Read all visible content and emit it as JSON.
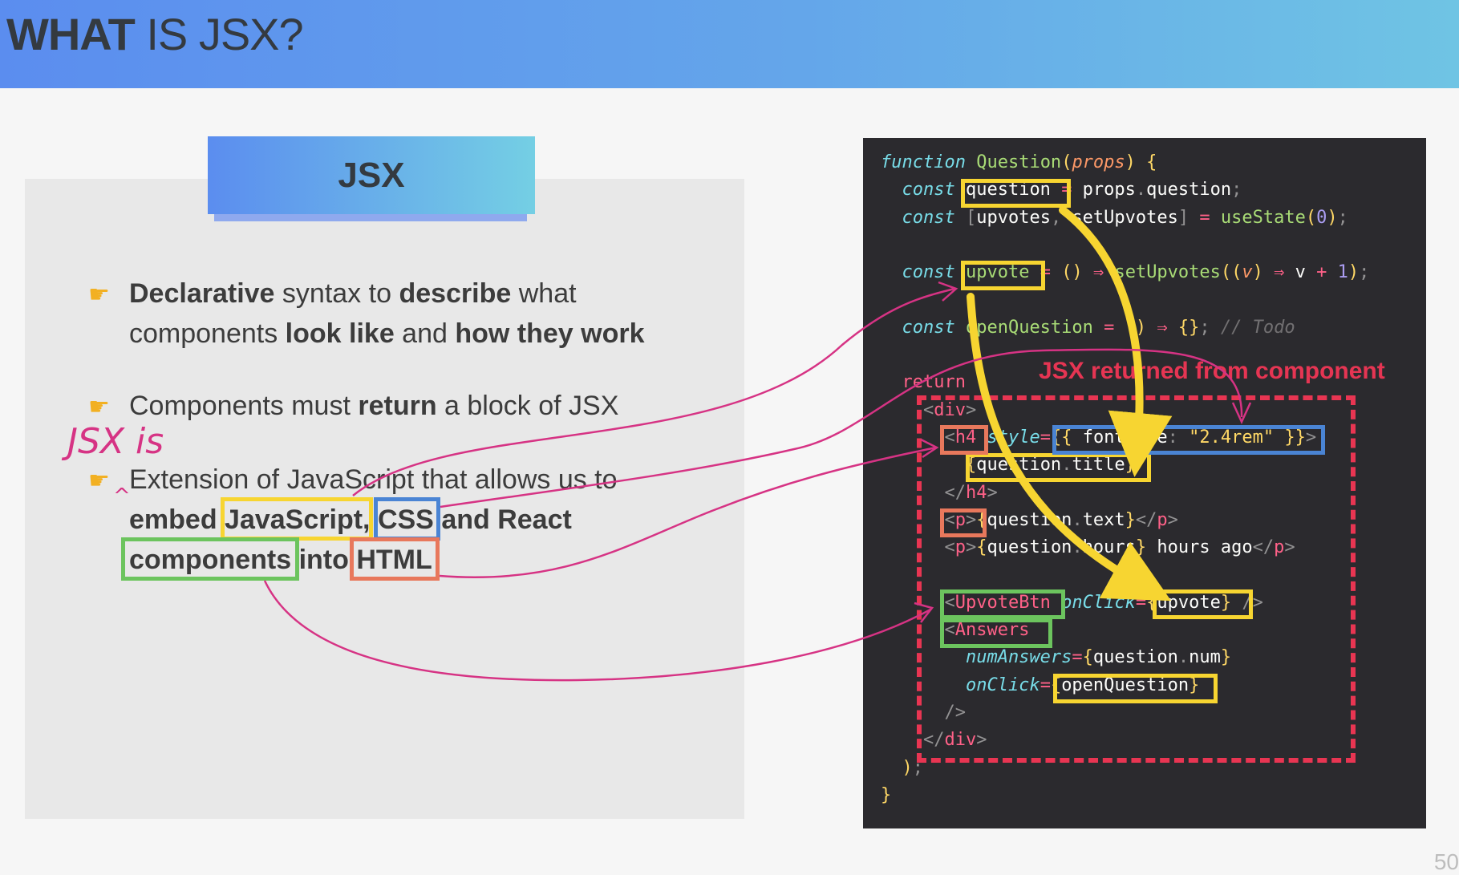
{
  "slide": {
    "title_bold": "WHAT",
    "title_rest": " IS JSX?",
    "page_number": "50"
  },
  "left": {
    "label": "JSX",
    "bullets": [
      {
        "icon": "pointing-hand-icon",
        "line1": [
          {
            "t": "Declarative",
            "b": true
          },
          {
            "t": " syntax to ",
            "b": false
          },
          {
            "t": "describe",
            "b": true
          },
          {
            "t": " what",
            "b": false
          }
        ],
        "line2": [
          {
            "t": "components ",
            "b": false
          },
          {
            "t": "look like",
            "b": true
          },
          {
            "t": " and ",
            "b": false
          },
          {
            "t": "how they work",
            "b": true
          }
        ]
      },
      {
        "icon": "pointing-hand-icon",
        "line1": [
          {
            "t": "Components must ",
            "b": false
          },
          {
            "t": "return",
            "b": true
          },
          {
            "t": " a block of JSX",
            "b": false
          }
        ]
      },
      {
        "icon": "pointing-hand-icon",
        "line1": [
          {
            "t": "Extension of JavaScript that allows us to",
            "b": false
          }
        ],
        "line2": [
          {
            "t": "embed ",
            "b": true
          },
          {
            "t": "JavaScript",
            "b": true
          },
          {
            "t": ", ",
            "b": true
          },
          {
            "t": "CSS",
            "b": true
          },
          {
            "t": " and React",
            "b": true
          }
        ],
        "line3": [
          {
            "t": "components",
            "b": true
          },
          {
            "t": " into ",
            "b": true
          },
          {
            "t": "HTML",
            "b": true
          }
        ]
      }
    ],
    "handwritten_note": "JSX is",
    "caret_mark": "^"
  },
  "code": {
    "lines": [
      [
        [
          "kw",
          "function"
        ],
        [
          "id",
          " "
        ],
        [
          "fn",
          "Question"
        ],
        [
          "br",
          "("
        ],
        [
          "param",
          "props"
        ],
        [
          "br",
          ")"
        ],
        [
          "id",
          " "
        ],
        [
          "br",
          "{"
        ]
      ],
      [
        [
          "kw",
          "  const"
        ],
        [
          "id",
          " "
        ],
        [
          "id",
          "question"
        ],
        [
          "id",
          " "
        ],
        [
          "op",
          "="
        ],
        [
          "id",
          " props"
        ],
        [
          "pct",
          "."
        ],
        [
          "id",
          "question"
        ],
        [
          "pct",
          ";"
        ]
      ],
      [
        [
          "kw",
          "  const"
        ],
        [
          "id",
          " "
        ],
        [
          "pct",
          "["
        ],
        [
          "id",
          "upvotes"
        ],
        [
          "pct",
          ", "
        ],
        [
          "id",
          "setUpvotes"
        ],
        [
          "pct",
          "]"
        ],
        [
          "id",
          " "
        ],
        [
          "op",
          "="
        ],
        [
          "id",
          " "
        ],
        [
          "fn",
          "useState"
        ],
        [
          "br",
          "("
        ],
        [
          "num",
          "0"
        ],
        [
          "br",
          ")"
        ],
        [
          "pct",
          ";"
        ]
      ],
      [],
      [
        [
          "kw",
          "  const"
        ],
        [
          "id",
          " "
        ],
        [
          "fn",
          "upvote"
        ],
        [
          "id",
          " "
        ],
        [
          "op",
          "="
        ],
        [
          "id",
          " "
        ],
        [
          "br",
          "()"
        ],
        [
          "id",
          " "
        ],
        [
          "op",
          "⇒"
        ],
        [
          "id",
          " "
        ],
        [
          "fn",
          "setUpvotes"
        ],
        [
          "br",
          "(("
        ],
        [
          "param",
          "v"
        ],
        [
          "br",
          ")"
        ],
        [
          "id",
          " "
        ],
        [
          "op",
          "⇒"
        ],
        [
          "id",
          " v "
        ],
        [
          "op",
          "+"
        ],
        [
          "id",
          " "
        ],
        [
          "num",
          "1"
        ],
        [
          "br",
          ")"
        ],
        [
          "pct",
          ";"
        ]
      ],
      [],
      [
        [
          "kw",
          "  const"
        ],
        [
          "id",
          " "
        ],
        [
          "fn",
          "openQuestion"
        ],
        [
          "id",
          " "
        ],
        [
          "op",
          "="
        ],
        [
          "id",
          " "
        ],
        [
          "br",
          "()"
        ],
        [
          "id",
          " "
        ],
        [
          "op",
          "⇒"
        ],
        [
          "id",
          " "
        ],
        [
          "br",
          "{}"
        ],
        [
          "pct",
          ";"
        ],
        [
          "id",
          " "
        ],
        [
          "cm",
          "// Todo"
        ]
      ],
      [],
      [
        [
          "op",
          "  return"
        ],
        [
          "id",
          " "
        ],
        [
          "br",
          "("
        ]
      ],
      [
        [
          "pct",
          "    <"
        ],
        [
          "tag",
          "div"
        ],
        [
          "pct",
          ">"
        ]
      ],
      [
        [
          "pct",
          "      <"
        ],
        [
          "tag",
          "h4"
        ],
        [
          "id",
          " "
        ],
        [
          "kw",
          "style"
        ],
        [
          "op",
          "="
        ],
        [
          "br",
          "{{"
        ],
        [
          "id",
          " fontSize"
        ],
        [
          "pct",
          ":"
        ],
        [
          "id",
          " "
        ],
        [
          "str",
          "\"2.4rem\""
        ],
        [
          "id",
          " "
        ],
        [
          "br",
          "}}"
        ],
        [
          "pct",
          ">"
        ]
      ],
      [
        [
          "br",
          "        {"
        ],
        [
          "id",
          "question"
        ],
        [
          "pct",
          "."
        ],
        [
          "id",
          "title"
        ],
        [
          "br",
          "}"
        ]
      ],
      [
        [
          "pct",
          "      </"
        ],
        [
          "tag",
          "h4"
        ],
        [
          "pct",
          ">"
        ]
      ],
      [
        [
          "pct",
          "      <"
        ],
        [
          "tag",
          "p"
        ],
        [
          "pct",
          ">"
        ],
        [
          "br",
          "{"
        ],
        [
          "id",
          "question"
        ],
        [
          "pct",
          "."
        ],
        [
          "id",
          "text"
        ],
        [
          "br",
          "}"
        ],
        [
          "pct",
          "</"
        ],
        [
          "tag",
          "p"
        ],
        [
          "pct",
          ">"
        ]
      ],
      [
        [
          "pct",
          "      <"
        ],
        [
          "tag",
          "p"
        ],
        [
          "pct",
          ">"
        ],
        [
          "br",
          "{"
        ],
        [
          "id",
          "question"
        ],
        [
          "pct",
          "."
        ],
        [
          "id",
          "hours"
        ],
        [
          "br",
          "}"
        ],
        [
          "id",
          " hours ago"
        ],
        [
          "pct",
          "</"
        ],
        [
          "tag",
          "p"
        ],
        [
          "pct",
          ">"
        ]
      ],
      [],
      [
        [
          "pct",
          "      <"
        ],
        [
          "tag",
          "UpvoteBtn"
        ],
        [
          "id",
          " "
        ],
        [
          "kw",
          "onClick"
        ],
        [
          "op",
          "="
        ],
        [
          "br",
          "{"
        ],
        [
          "id",
          "upvote"
        ],
        [
          "br",
          "}"
        ],
        [
          "id",
          " "
        ],
        [
          "pct",
          "/>"
        ]
      ],
      [
        [
          "pct",
          "      <"
        ],
        [
          "tag",
          "Answers"
        ]
      ],
      [
        [
          "kw",
          "        numAnswers"
        ],
        [
          "op",
          "="
        ],
        [
          "br",
          "{"
        ],
        [
          "id",
          "question"
        ],
        [
          "pct",
          "."
        ],
        [
          "id",
          "num"
        ],
        [
          "br",
          "}"
        ]
      ],
      [
        [
          "kw",
          "        onClick"
        ],
        [
          "op",
          "="
        ],
        [
          "br",
          "{"
        ],
        [
          "id",
          "openQuestion"
        ],
        [
          "br",
          "}"
        ]
      ],
      [
        [
          "pct",
          "      />"
        ]
      ],
      [
        [
          "pct",
          "    </"
        ],
        [
          "tag",
          "div"
        ],
        [
          "pct",
          ">"
        ]
      ],
      [
        [
          "br",
          "  )"
        ],
        [
          "pct",
          ";"
        ]
      ],
      [
        [
          "br",
          "}"
        ]
      ]
    ],
    "annotation": "JSX returned from component"
  },
  "colors": {
    "yellow": "#f7d531",
    "blue": "#4a84d4",
    "green": "#6cc45e",
    "orange": "#e8785c",
    "pink_line": "#d63384",
    "red_dash": "#e83552"
  }
}
